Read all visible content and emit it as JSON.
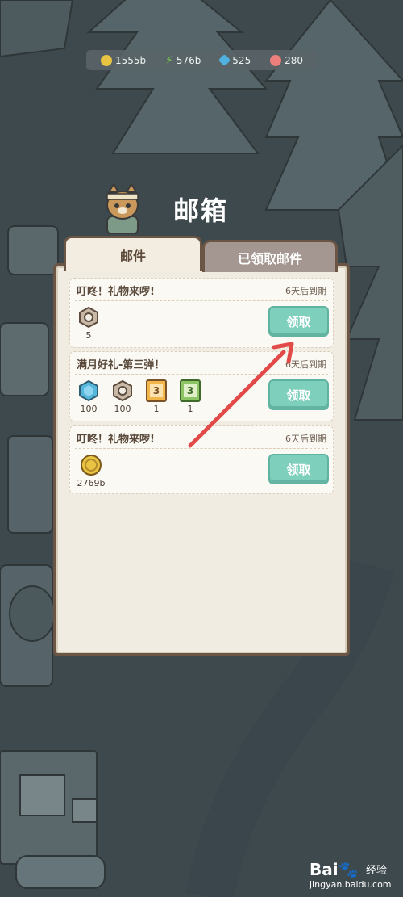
{
  "currencies": [
    {
      "icon": "gold-coin-icon",
      "value": "1555b",
      "color": "#e9c443"
    },
    {
      "icon": "green-leaf-icon",
      "value": "576b",
      "color": "#79c44a"
    },
    {
      "icon": "blue-gem-icon",
      "value": "525",
      "color": "#4fb2e0"
    },
    {
      "icon": "pink-shell-icon",
      "value": "280",
      "color": "#ec7f7b"
    }
  ],
  "title": "邮箱",
  "tabs": {
    "mail": "邮件",
    "claimed": "已领取邮件"
  },
  "mails": [
    {
      "title": "叮咚！礼物来啰!",
      "expire": "6天后到期",
      "claim_label": "领取",
      "rewards": [
        {
          "icon": "nut-icon",
          "amount": "5"
        }
      ]
    },
    {
      "title": "满月好礼-第三弹！",
      "expire": "6天后到期",
      "claim_label": "领取",
      "rewards": [
        {
          "icon": "blue-gem-icon",
          "amount": "100"
        },
        {
          "icon": "nut-icon",
          "amount": "100"
        },
        {
          "icon": "orange-ticket-icon",
          "amount": "1",
          "label": "3"
        },
        {
          "icon": "green-ticket-icon",
          "amount": "1",
          "label": "3"
        }
      ]
    },
    {
      "title": "叮咚！礼物来啰!",
      "expire": "6天后到期",
      "claim_label": "领取",
      "rewards": [
        {
          "icon": "gold-coin-icon",
          "amount": "2769b"
        }
      ]
    }
  ],
  "watermark": {
    "logo": "Bai🐾",
    "brand": "经验",
    "url": "jingyan.baidu.com"
  }
}
